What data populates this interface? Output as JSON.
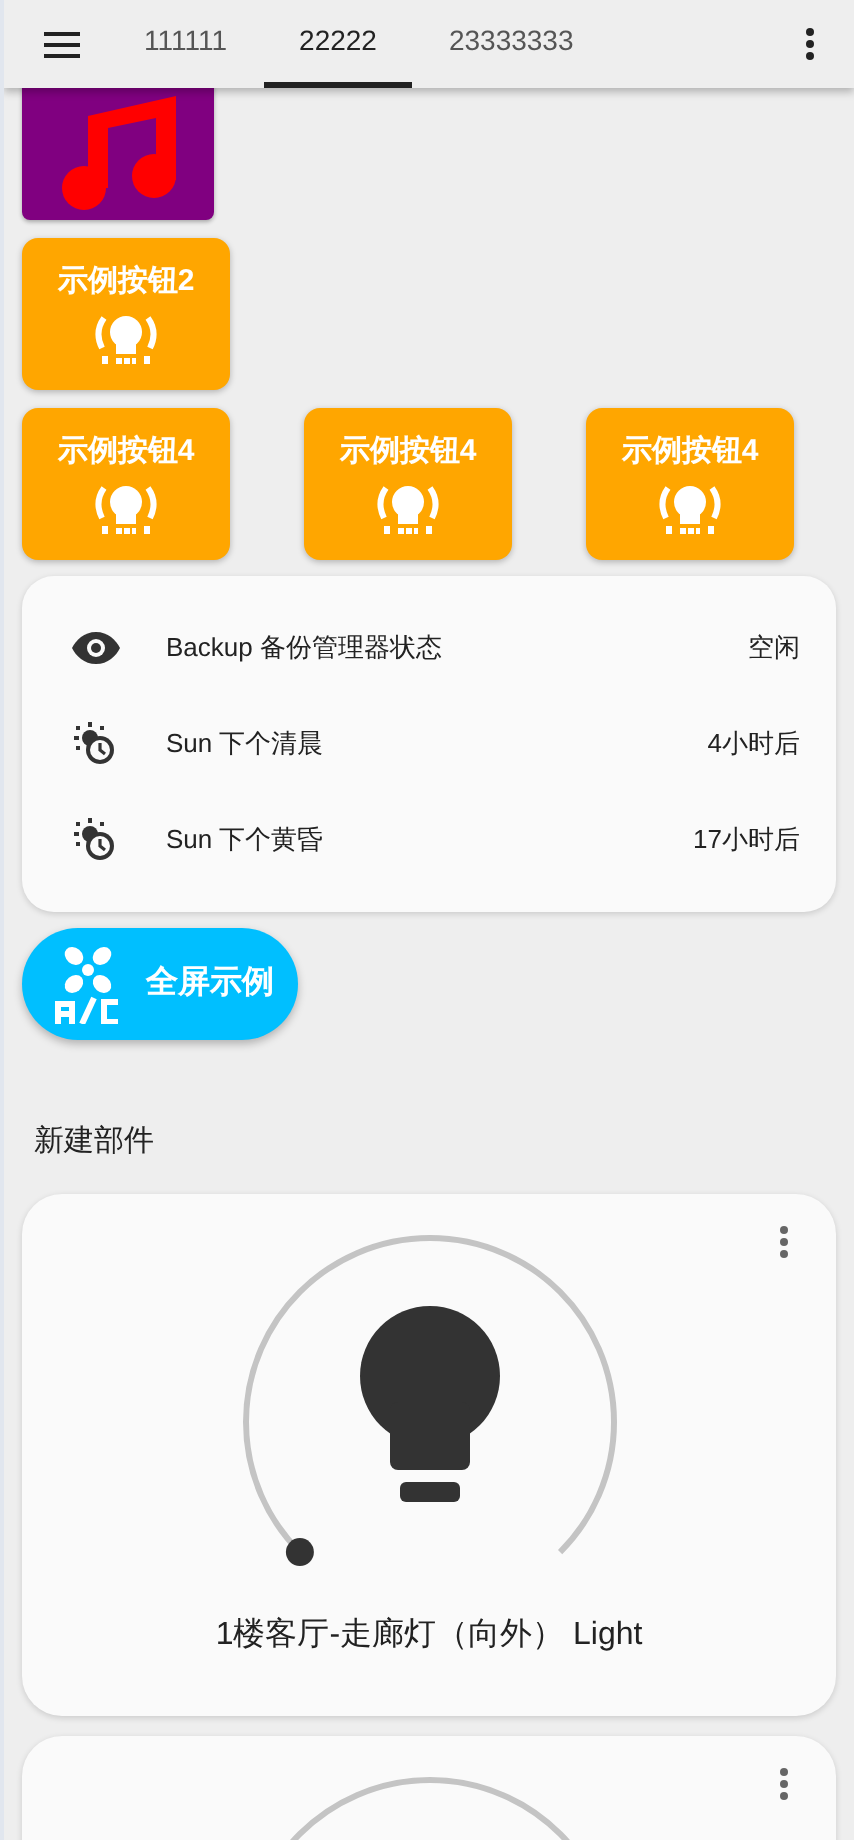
{
  "tabs": [
    {
      "label": "111111",
      "selected": false
    },
    {
      "label": "22222",
      "selected": true
    },
    {
      "label": "23333333",
      "selected": false
    }
  ],
  "button_rows": [
    [
      {
        "label": "示例按钮2"
      }
    ],
    [
      {
        "label": "示例按钮4"
      },
      {
        "label": "示例按钮4"
      },
      {
        "label": "示例按钮4"
      }
    ]
  ],
  "entities": [
    {
      "kind": "eye",
      "name": "Backup 备份管理器状态",
      "state": "空闲"
    },
    {
      "kind": "sun-clock",
      "name": "Sun 下个清晨",
      "state": "4小时后"
    },
    {
      "kind": "sun-clock",
      "name": "Sun 下个黄昏",
      "state": "17小时后"
    }
  ],
  "fullscreen_button": {
    "label": "全屏示例"
  },
  "section_title": "新建部件",
  "light_cards": [
    {
      "kind": "full",
      "name": "1楼客厅-走廊灯（向外） Light"
    },
    {
      "kind": "partial"
    }
  ]
}
